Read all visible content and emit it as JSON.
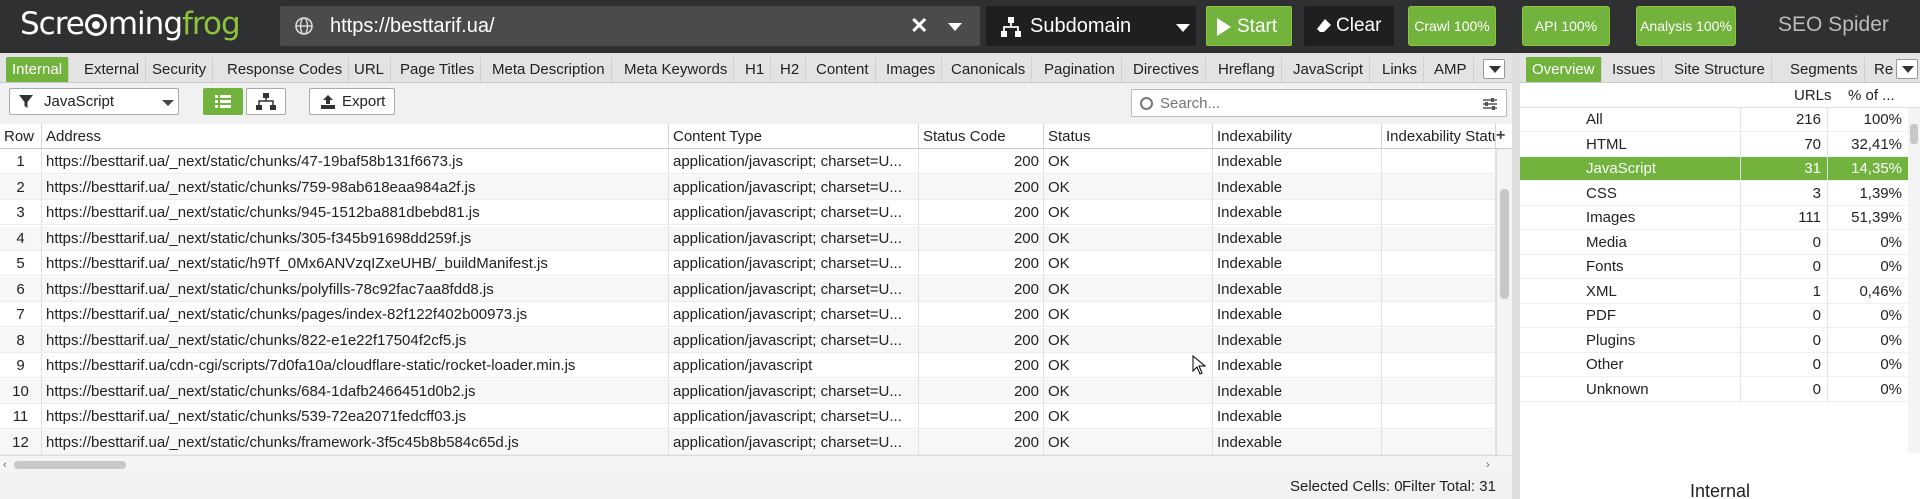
{
  "topbar": {
    "logo_pre": "Scre",
    "logo_mid": "ming",
    "logo_post": "frog",
    "url": "https://besttarif.ua/",
    "mode": "Subdomain",
    "start_label": "Start",
    "clear_label": "Clear",
    "crawl_label": "Crawl 100%",
    "api_label": "API 100%",
    "analysis_label": "Analysis 100%",
    "brand": "SEO Spider"
  },
  "tabs": [
    "Internal",
    "External",
    "Security",
    "Response Codes",
    "URL",
    "Page Titles",
    "Meta Description",
    "Meta Keywords",
    "H1",
    "H2",
    "Content",
    "Images",
    "Canonicals",
    "Pagination",
    "Directives",
    "Hreflang",
    "JavaScript",
    "Links",
    "AMP"
  ],
  "toolbar": {
    "filter": "JavaScript",
    "export_label": "Export",
    "search_placeholder": "Search..."
  },
  "table": {
    "headers": [
      "Row",
      "Address",
      "Content Type",
      "Status Code",
      "Status",
      "Indexability",
      "Indexability Status"
    ],
    "rows": [
      [
        "1",
        "https://besttarif.ua/_next/static/chunks/47-19baf58b131f6673.js",
        "application/javascript; charset=U...",
        "200",
        "OK",
        "Indexable",
        ""
      ],
      [
        "2",
        "https://besttarif.ua/_next/static/chunks/759-98ab618eaa984a2f.js",
        "application/javascript; charset=U...",
        "200",
        "OK",
        "Indexable",
        ""
      ],
      [
        "3",
        "https://besttarif.ua/_next/static/chunks/945-1512ba881dbebd81.js",
        "application/javascript; charset=U...",
        "200",
        "OK",
        "Indexable",
        ""
      ],
      [
        "4",
        "https://besttarif.ua/_next/static/chunks/305-f345b91698dd259f.js",
        "application/javascript; charset=U...",
        "200",
        "OK",
        "Indexable",
        ""
      ],
      [
        "5",
        "https://besttarif.ua/_next/static/h9Tf_0Mx6ANVzqIZxeUHB/_buildManifest.js",
        "application/javascript; charset=U...",
        "200",
        "OK",
        "Indexable",
        ""
      ],
      [
        "6",
        "https://besttarif.ua/_next/static/chunks/polyfills-78c92fac7aa8fdd8.js",
        "application/javascript; charset=U...",
        "200",
        "OK",
        "Indexable",
        ""
      ],
      [
        "7",
        "https://besttarif.ua/_next/static/chunks/pages/index-82f122f402b00973.js",
        "application/javascript; charset=U...",
        "200",
        "OK",
        "Indexable",
        ""
      ],
      [
        "8",
        "https://besttarif.ua/_next/static/chunks/822-e1e22f17504f2cf5.js",
        "application/javascript; charset=U...",
        "200",
        "OK",
        "Indexable",
        ""
      ],
      [
        "9",
        "https://besttarif.ua/cdn-cgi/scripts/7d0fa10a/cloudflare-static/rocket-loader.min.js",
        "application/javascript",
        "200",
        "OK",
        "Indexable",
        ""
      ],
      [
        "10",
        "https://besttarif.ua/_next/static/chunks/684-1dafb2466451d0b2.js",
        "application/javascript; charset=U...",
        "200",
        "OK",
        "Indexable",
        ""
      ],
      [
        "11",
        "https://besttarif.ua/_next/static/chunks/539-72ea2071fedcff03.js",
        "application/javascript; charset=U...",
        "200",
        "OK",
        "Indexable",
        ""
      ],
      [
        "12",
        "https://besttarif.ua/_next/static/chunks/framework-3f5c45b8b584c65d.js",
        "application/javascript; charset=U...",
        "200",
        "OK",
        "Indexable",
        ""
      ]
    ]
  },
  "status": {
    "selected_cells": "Selected Cells:  0",
    "filter_total": "Filter Total:  31"
  },
  "right_panel": {
    "tabs": [
      "Overview",
      "Issues",
      "Site Structure",
      "Segments",
      "Re"
    ],
    "col_urls": "URLs",
    "col_pct": "% of ...",
    "rows": [
      {
        "name": "All",
        "urls": "216",
        "pct": "100%"
      },
      {
        "name": "HTML",
        "urls": "70",
        "pct": "32,41%"
      },
      {
        "name": "JavaScript",
        "urls": "31",
        "pct": "14,35%"
      },
      {
        "name": "CSS",
        "urls": "3",
        "pct": "1,39%"
      },
      {
        "name": "Images",
        "urls": "111",
        "pct": "51,39%"
      },
      {
        "name": "Media",
        "urls": "0",
        "pct": "0%"
      },
      {
        "name": "Fonts",
        "urls": "0",
        "pct": "0%"
      },
      {
        "name": "XML",
        "urls": "1",
        "pct": "0,46%"
      },
      {
        "name": "PDF",
        "urls": "0",
        "pct": "0%"
      },
      {
        "name": "Plugins",
        "urls": "0",
        "pct": "0%"
      },
      {
        "name": "Other",
        "urls": "0",
        "pct": "0%"
      },
      {
        "name": "Unknown",
        "urls": "0",
        "pct": "0%"
      }
    ],
    "selected_index": 2,
    "footer": "Internal"
  },
  "colors": {
    "accent": "#72b33e",
    "topbar": "#2f3031"
  }
}
